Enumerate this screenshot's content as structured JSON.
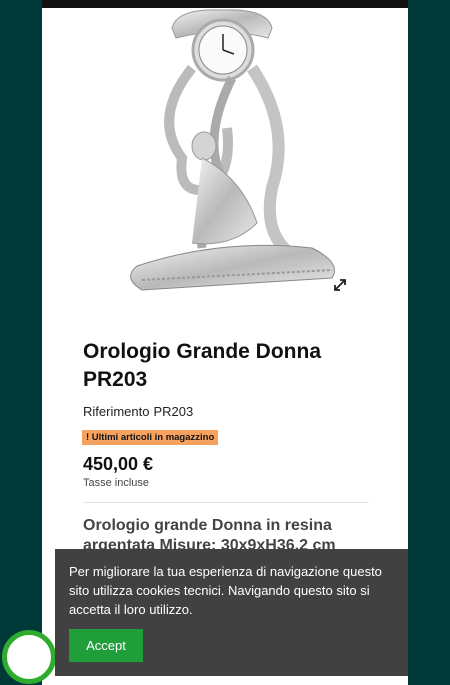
{
  "product": {
    "title": "Orologio Grande Donna PR203",
    "reference_label": "Riferimento",
    "reference_value": "PR203",
    "stock_badge": "! Ultimi articoli in magazzino",
    "price": "450,00 €",
    "tax_note": "Tasse incluse",
    "description": "Orologio grande Donna in resina argentata Misure: 30x9xH36,2 cm"
  },
  "cookie_banner": {
    "text": "Per migliorare la tua esperienza di navigazione questo sito utilizza cookies tecnici. Navigando questo sito si accetta il loro utilizzo.",
    "accept_label": "Accept"
  },
  "colors": {
    "page_background": "#003a38",
    "stock_badge": "#f7a15f",
    "accept_button": "#1f9e3a",
    "cookie_banner": "#414141"
  },
  "icons": [
    "expand-icon"
  ]
}
